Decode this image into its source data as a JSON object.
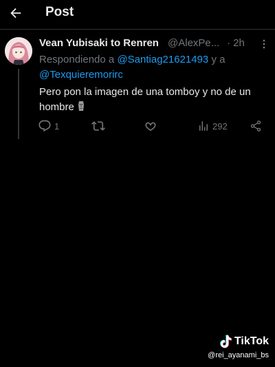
{
  "header": {
    "title": "Post",
    "back_icon": "arrow-left-icon"
  },
  "tweet": {
    "author_name": "Vean Yubisaki to Renren",
    "author_handle": "@AlexPe...",
    "separator": "·",
    "time": "2h",
    "reply_prefix": "Respondiendo a",
    "reply_mention_1": "@Santiag21621493",
    "reply_joiner": "y a",
    "reply_mention_2": "@Texquieremorirc",
    "text": "Pero pon la imagen de una tomboy y no de un hombre",
    "text_emoji": "moai-icon"
  },
  "actions": {
    "reply_count": "1",
    "retweet_count": "",
    "like_count": "",
    "views_count": "292"
  },
  "watermark": {
    "brand": "TikTok",
    "username": "@rei_ayanami_bs"
  },
  "colors": {
    "background": "#000000",
    "text": "#e7e9ea",
    "muted": "#71767b",
    "accent": "#1d9bf0"
  }
}
